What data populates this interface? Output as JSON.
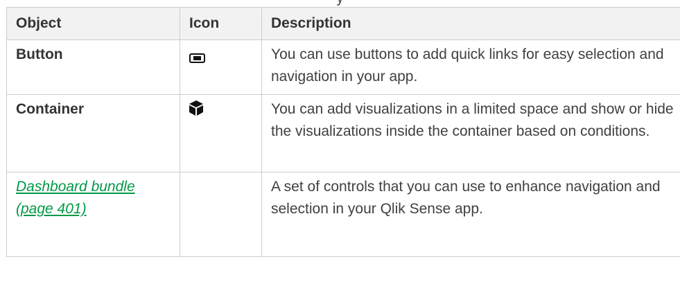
{
  "table": {
    "headers": {
      "object": "Object",
      "icon": "Icon",
      "description": "Description"
    },
    "rows": [
      {
        "object": "Button",
        "icon": "button-icon",
        "description": "You can use buttons to add quick links for easy selection and navigation in your app."
      },
      {
        "object": "Container",
        "icon": "container-cube-icon",
        "description": "You can add visualizations in a limited space and show or hide the visualizations inside the container based on conditions."
      },
      {
        "object": "Dashboard bundle (page 401)",
        "icon": "",
        "description": "A set of controls that you can use to enhance navigation and selection in your Qlik Sense app.",
        "is_link": true
      }
    ]
  },
  "colors": {
    "header_bg": "#f2f2f2",
    "border": "#cccccc",
    "link": "#009845",
    "text": "#404040"
  }
}
